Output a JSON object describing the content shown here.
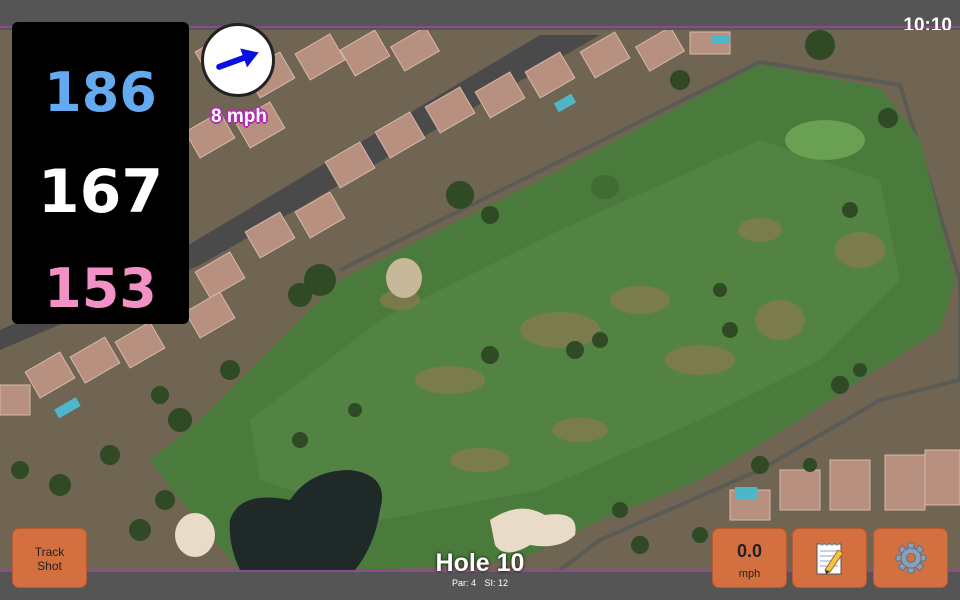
{
  "status": {
    "time": "10:10"
  },
  "yardages": {
    "back": "186",
    "middle": "167",
    "front": "153"
  },
  "wind": {
    "speed_label": "8 mph",
    "arrow_icon": "arrow-right-icon"
  },
  "hole": {
    "title": "Hole 10",
    "par_label": "Par: 4",
    "si_label": "SI: 12"
  },
  "buttons": {
    "track_shot_line1": "Track",
    "track_shot_line2": "Shot",
    "speed_value": "0.0",
    "speed_unit": "mph",
    "notes_icon": "notepad-icon",
    "settings_icon": "gear-icon"
  },
  "colors": {
    "back": "#64aaf0",
    "middle": "#ffffff",
    "front": "#f291c6",
    "button": "#d4703f",
    "accent": "#8e4a8e"
  }
}
